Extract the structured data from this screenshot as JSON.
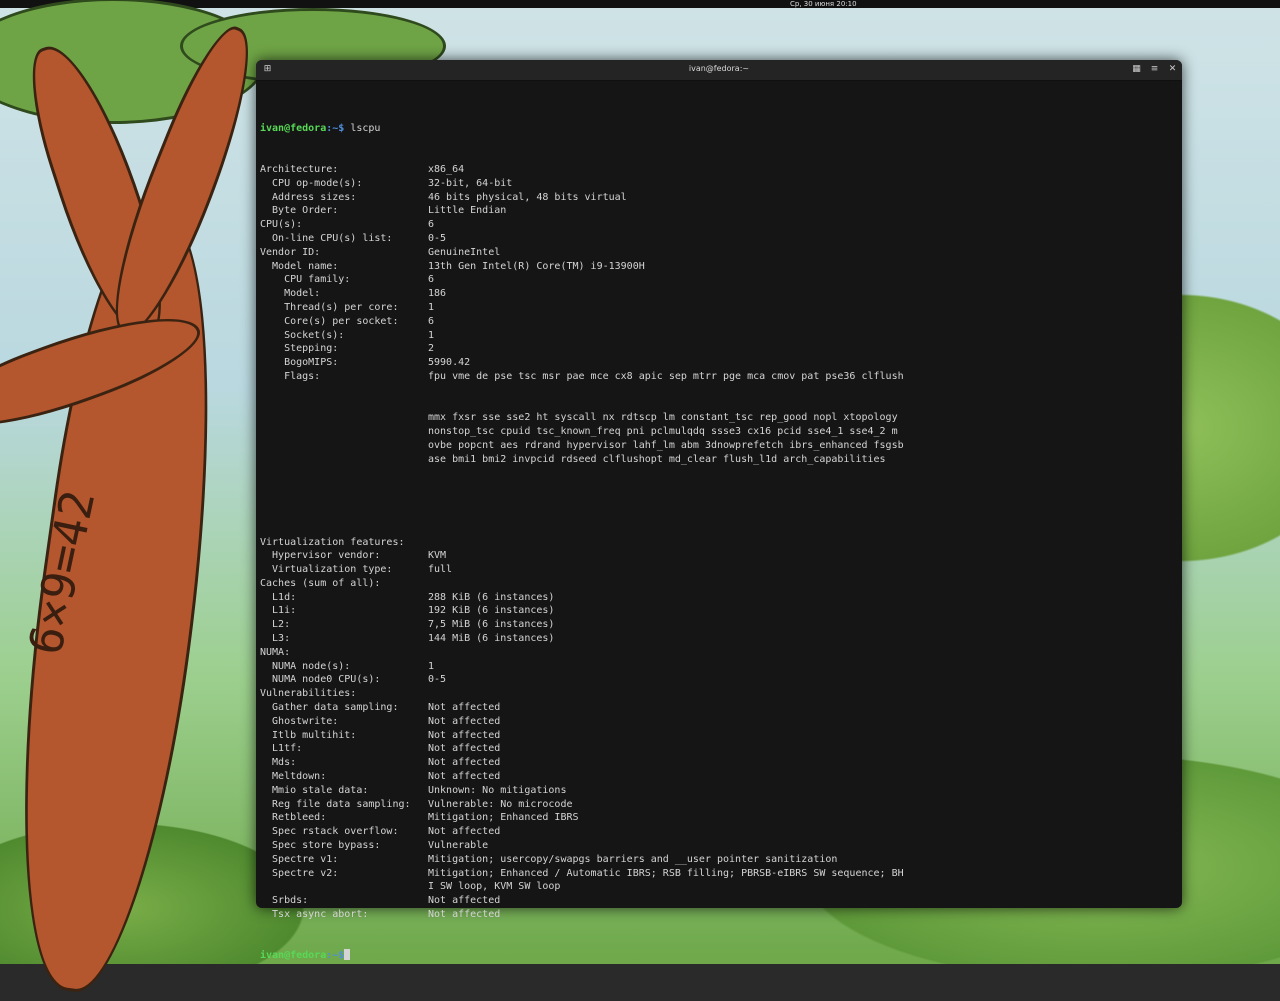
{
  "topbar": {
    "clock": "Ср, 30 июня 20:10"
  },
  "wallpaper": {
    "carving": "6×9=42"
  },
  "window": {
    "title": "ivan@fedora:~",
    "buttons": [
      "menu-icon",
      "hamburger-icon",
      "close-icon"
    ]
  },
  "terminal": {
    "prompt_user": "ivan@fedora",
    "prompt_path": ":~$",
    "command": " lscpu",
    "rows1": [
      {
        "k": "Architecture:",
        "v": "x86_64"
      },
      {
        "k": "  CPU op-mode(s):",
        "v": "32-bit, 64-bit"
      },
      {
        "k": "  Address sizes:",
        "v": "46 bits physical, 48 bits virtual"
      },
      {
        "k": "  Byte Order:",
        "v": "Little Endian"
      },
      {
        "k": "CPU(s):",
        "v": "6"
      },
      {
        "k": "  On-line CPU(s) list:",
        "v": "0-5"
      },
      {
        "k": "Vendor ID:",
        "v": "GenuineIntel"
      },
      {
        "k": "  Model name:",
        "v": "13th Gen Intel(R) Core(TM) i9-13900H"
      },
      {
        "k": "    CPU family:",
        "v": "6"
      },
      {
        "k": "    Model:",
        "v": "186"
      },
      {
        "k": "    Thread(s) per core:",
        "v": "1"
      },
      {
        "k": "    Core(s) per socket:",
        "v": "6"
      },
      {
        "k": "    Socket(s):",
        "v": "1"
      },
      {
        "k": "    Stepping:",
        "v": "2"
      },
      {
        "k": "    BogoMIPS:",
        "v": "5990.42"
      },
      {
        "k": "    Flags:",
        "v": "fpu vme de pse tsc msr pae mce cx8 apic sep mtrr pge mca cmov pat pse36 clflush"
      }
    ],
    "flags_cont": [
      "mmx fxsr sse sse2 ht syscall nx rdtscp lm constant_tsc rep_good nopl xtopology",
      "nonstop_tsc cpuid tsc_known_freq pni pclmulqdq ssse3 cx16 pcid sse4_1 sse4_2 m",
      "ovbe popcnt aes rdrand hypervisor lahf_lm abm 3dnowprefetch ibrs_enhanced fsgsb",
      "ase bmi1 bmi2 invpcid rdseed clflushopt md_clear flush_l1d arch_capabilities"
    ],
    "rows2": [
      {
        "k": "Virtualization features:",
        "v": ""
      },
      {
        "k": "  Hypervisor vendor:",
        "v": "KVM"
      },
      {
        "k": "  Virtualization type:",
        "v": "full"
      },
      {
        "k": "Caches (sum of all):",
        "v": ""
      },
      {
        "k": "  L1d:",
        "v": "288 KiB (6 instances)"
      },
      {
        "k": "  L1i:",
        "v": "192 KiB (6 instances)"
      },
      {
        "k": "  L2:",
        "v": "7,5 MiB (6 instances)"
      },
      {
        "k": "  L3:",
        "v": "144 MiB (6 instances)"
      },
      {
        "k": "NUMA:",
        "v": ""
      },
      {
        "k": "  NUMA node(s):",
        "v": "1"
      },
      {
        "k": "  NUMA node0 CPU(s):",
        "v": "0-5"
      },
      {
        "k": "Vulnerabilities:",
        "v": ""
      },
      {
        "k": "  Gather data sampling:",
        "v": "Not affected"
      },
      {
        "k": "  Ghostwrite:",
        "v": "Not affected"
      },
      {
        "k": "  Itlb multihit:",
        "v": "Not affected"
      },
      {
        "k": "  L1tf:",
        "v": "Not affected"
      },
      {
        "k": "  Mds:",
        "v": "Not affected"
      },
      {
        "k": "  Meltdown:",
        "v": "Not affected"
      },
      {
        "k": "  Mmio stale data:",
        "v": "Unknown: No mitigations"
      },
      {
        "k": "  Reg file data sampling:",
        "v": "Vulnerable: No microcode"
      },
      {
        "k": "  Retbleed:",
        "v": "Mitigation; Enhanced IBRS"
      },
      {
        "k": "  Spec rstack overflow:",
        "v": "Not affected"
      },
      {
        "k": "  Spec store bypass:",
        "v": "Vulnerable"
      },
      {
        "k": "  Spectre v1:",
        "v": "Mitigation; usercopy/swapgs barriers and __user pointer sanitization"
      },
      {
        "k": "  Spectre v2:",
        "v": "Mitigation; Enhanced / Automatic IBRS; RSB filling; PBRSB-eIBRS SW sequence; BH"
      },
      {
        "k": "",
        "v": "I SW loop, KVM SW loop"
      },
      {
        "k": "  Srbds:",
        "v": "Not affected"
      },
      {
        "k": "  Tsx async abort:",
        "v": "Not affected"
      }
    ]
  }
}
